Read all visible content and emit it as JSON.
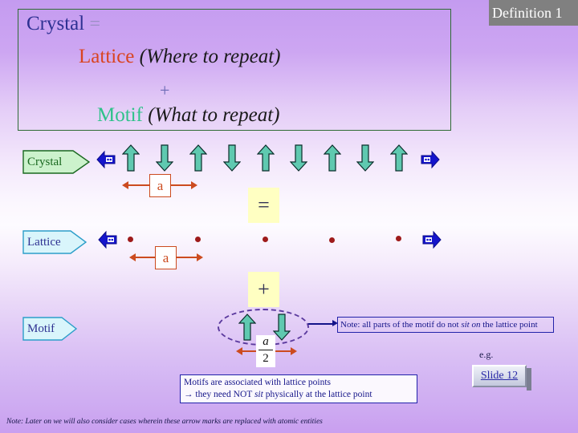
{
  "banner": {
    "label": "Definition 1"
  },
  "title": {
    "crystal_word": "Crystal",
    "equals": "=",
    "lattice_word": "Lattice",
    "lattice_paren": "(Where to repeat)",
    "plus": "+",
    "motif_word": "Motif",
    "motif_paren": "(What to repeat)"
  },
  "rows": {
    "crystal_label": "Crystal",
    "lattice_label": "Lattice",
    "motif_label": "Motif"
  },
  "operators": {
    "equals": "=",
    "plus": "+"
  },
  "dimensions": {
    "crystal_a": "a",
    "lattice_a": "a",
    "motif_numerator": "a",
    "motif_denominator": "2"
  },
  "note": {
    "text_before": "Note: all parts of the motif do not ",
    "text_italic": "sit on",
    "text_after": " the lattice point"
  },
  "info": {
    "line1": "Motifs are associated with lattice points",
    "line2_before": "→ they need NOT ",
    "line2_italic": "sit",
    "line2_after": " physically at the lattice point"
  },
  "example": {
    "eg_label": "e.g.",
    "slide_link": "Slide 12"
  },
  "footer": {
    "note": "Note: Later on we will also consider cases wherein these arrow marks are replaced with atomic entities"
  },
  "colors": {
    "crystal_text": "#2e3192",
    "lattice_text": "#d94420",
    "motif_text": "#2fc28a",
    "banner_bg": "#808080",
    "spin_arrow": "#5fc9b0",
    "nav_arrow": "#1515cc",
    "lattice_dot": "#9e1b1b",
    "dimension": "#cc4b1f",
    "operator_box": "#ffffc2"
  },
  "spins": {
    "crystal_row": [
      "up",
      "down",
      "up",
      "down",
      "up",
      "down",
      "up",
      "down",
      "up"
    ],
    "motif_group": [
      "up",
      "down"
    ]
  },
  "lattice_points_count": 5
}
